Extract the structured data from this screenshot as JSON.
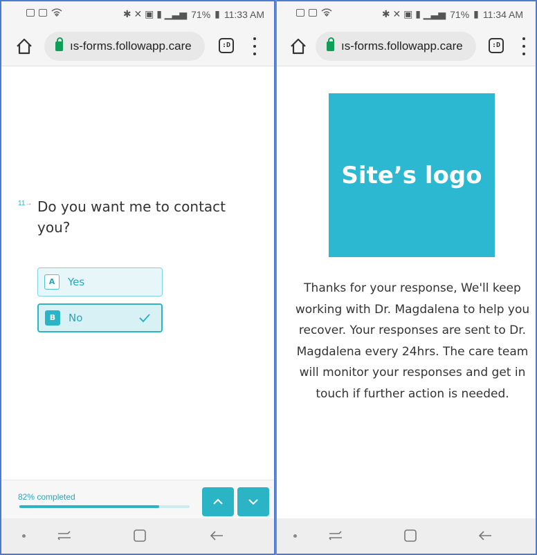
{
  "left": {
    "status": {
      "battery": "71%",
      "time": "11:33 AM"
    },
    "url": "ıs-forms.followapp.care",
    "question": {
      "number": "11→",
      "text": "Do you want me to contact you?"
    },
    "options": [
      {
        "key": "A",
        "label": "Yes",
        "selected": false
      },
      {
        "key": "B",
        "label": "No",
        "selected": true
      }
    ],
    "progress": {
      "label": "82% completed",
      "fraction": 0.82
    }
  },
  "right": {
    "status": {
      "battery": "71%",
      "time": "11:34 AM"
    },
    "url": "ıs-forms.followapp.care",
    "logo": {
      "text": "Site’s logo",
      "color": "#2bb8d0"
    },
    "thanks": "Thanks for your response, We'll keep working with Dr. Magdalena to help you recover. Your responses are sent to Dr. Magdalena every 24hrs. The care team will monitor your responses and get in touch if further action is needed."
  },
  "icons": [
    "home-icon",
    "lock-icon",
    "tab-switcher-icon",
    "more-menu-icon",
    "check-icon",
    "chevron-up-icon",
    "chevron-down-icon",
    "recent-apps-icon",
    "overview-icon",
    "back-icon"
  ],
  "colors": {
    "accent": "#2bb3c6",
    "frame": "#4a7bd0"
  }
}
